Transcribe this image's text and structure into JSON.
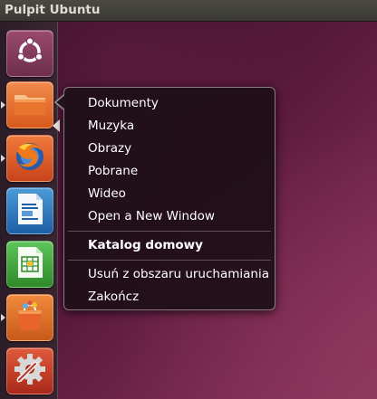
{
  "top_panel": {
    "title": "Pulpit Ubuntu"
  },
  "launcher": {
    "items": [
      {
        "name": "ubuntu-home-icon",
        "running": false
      },
      {
        "name": "folder-icon",
        "running": true
      },
      {
        "name": "firefox-icon",
        "running": true
      },
      {
        "name": "writer-icon",
        "running": false
      },
      {
        "name": "calc-icon",
        "running": false
      },
      {
        "name": "software-center-icon",
        "running": true
      },
      {
        "name": "settings-icon",
        "running": false
      }
    ]
  },
  "quicklist": {
    "places": [
      "Dokumenty",
      "Muzyka",
      "Obrazy",
      "Pobrane",
      "Wideo",
      "Open a New Window"
    ],
    "app_title": "Katalog domowy",
    "actions": [
      "Usuń z obszaru uruchamiania",
      "Zakończ"
    ]
  },
  "colors": {
    "panel": "#3c3b37",
    "accent_orange": "#dd4814",
    "wallpaper": "#5b1a3c"
  }
}
